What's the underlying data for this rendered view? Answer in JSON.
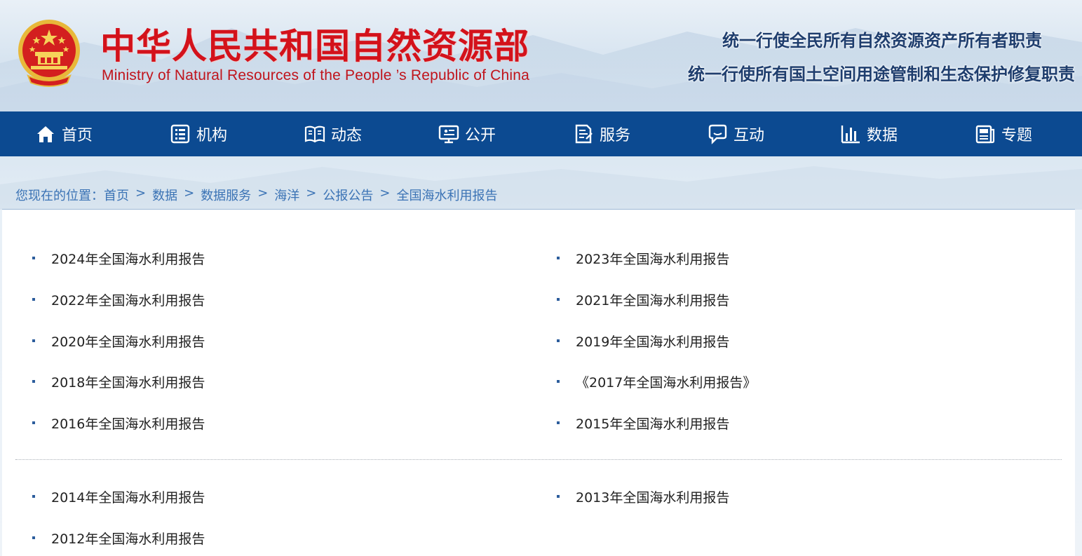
{
  "header": {
    "title_cn": "中华人民共和国自然资源部",
    "title_en": "Ministry of Natural Resources of the People ’s Republic of China",
    "slogan_1": "统一行使全民所有自然资源资产所有者职责",
    "slogan_2": "统一行使所有国土空间用途管制和生态保护修复职责",
    "brand_red": "#d3121b",
    "nav_blue": "#0c4a91"
  },
  "nav": {
    "items": [
      {
        "label": "首页",
        "icon": "home-icon"
      },
      {
        "label": "机构",
        "icon": "organization-icon"
      },
      {
        "label": "动态",
        "icon": "book-icon"
      },
      {
        "label": "公开",
        "icon": "monitor-icon"
      },
      {
        "label": "服务",
        "icon": "form-icon"
      },
      {
        "label": "互动",
        "icon": "chat-icon"
      },
      {
        "label": "数据",
        "icon": "bar-chart-icon"
      },
      {
        "label": "专题",
        "icon": "newspaper-icon"
      }
    ]
  },
  "breadcrumb": {
    "prefix": "您现在的位置：",
    "items": [
      "首页",
      "数据",
      "数据服务",
      "海洋",
      "公报公告",
      "全国海水利用报告"
    ],
    "separator": ">"
  },
  "reports": {
    "group_1": [
      "2024年全国海水利用报告",
      "2023年全国海水利用报告",
      "2022年全国海水利用报告",
      "2021年全国海水利用报告",
      "2020年全国海水利用报告",
      "2019年全国海水利用报告",
      "2018年全国海水利用报告",
      "《2017年全国海水利用报告》",
      "2016年全国海水利用报告",
      "2015年全国海水利用报告"
    ],
    "group_2": [
      "2014年全国海水利用报告",
      "2013年全国海水利用报告",
      "2012年全国海水利用报告"
    ]
  }
}
